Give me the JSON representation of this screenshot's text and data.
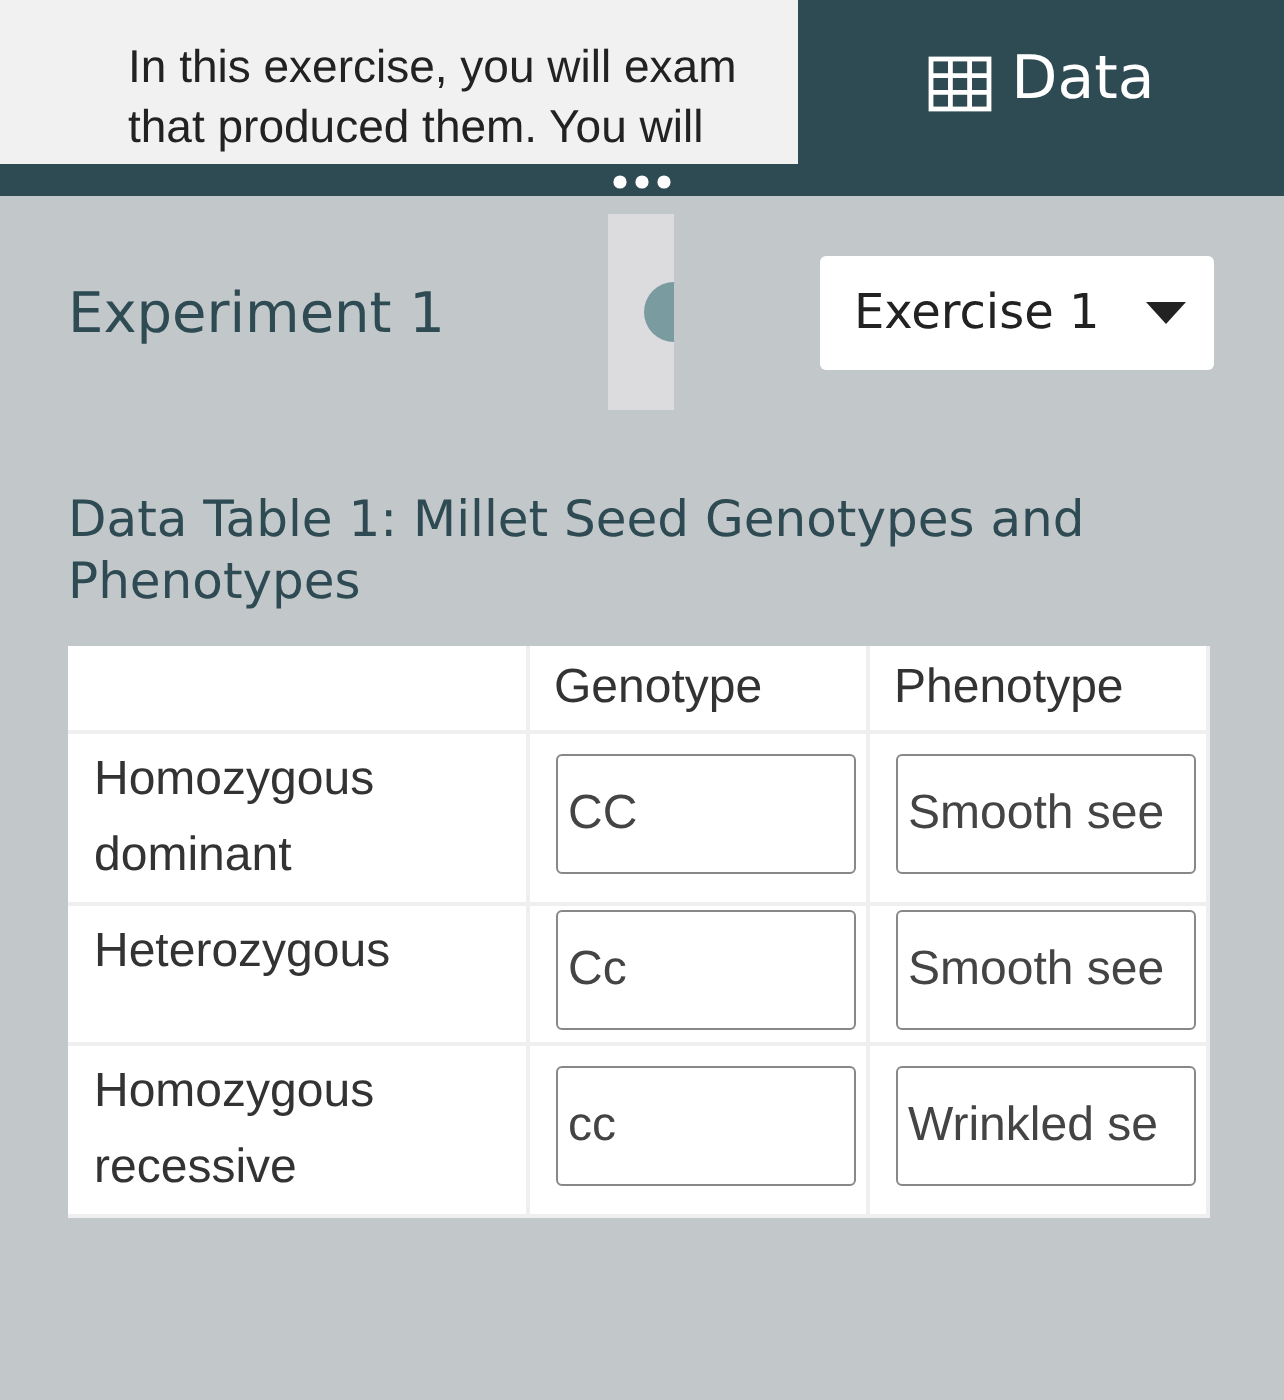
{
  "intro": {
    "lines": [
      "In this exercise, you will exam",
      "that produced them. You will"
    ]
  },
  "data_tab": {
    "label": "Data"
  },
  "experiment": {
    "title": "Experiment 1"
  },
  "exercise_select": {
    "value": "Exercise 1"
  },
  "table": {
    "title": "Data Table 1: Millet Seed Genotypes and Phenotypes",
    "columns": [
      "Genotype",
      "Phenotype"
    ],
    "rows": [
      {
        "label": "Homozygous dominant",
        "genotype": "CC",
        "phenotype": "Smooth see"
      },
      {
        "label": "Heterozygous",
        "genotype": "Cc",
        "phenotype": "Smooth see"
      },
      {
        "label": "Homozygous recessive",
        "genotype": "cc",
        "phenotype": "Wrinkled se"
      }
    ]
  }
}
